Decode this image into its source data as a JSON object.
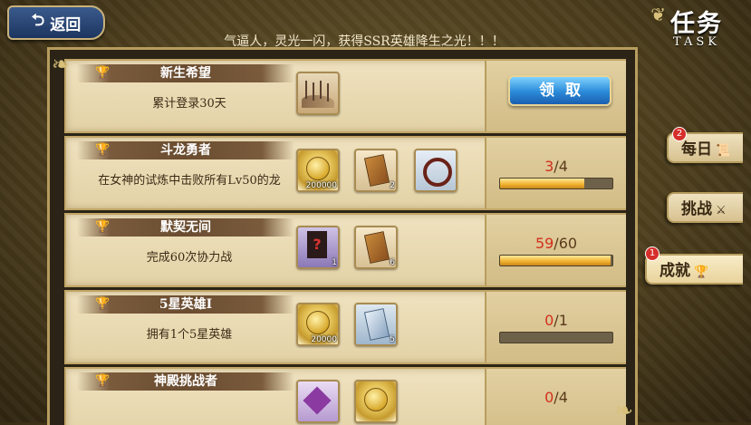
{
  "header": {
    "back_label": "返回",
    "title_cn": "任务",
    "title_en": "TASK",
    "marquee": "气逼人，灵光一闪，获得SSR英雄降生之光！！！"
  },
  "tabs": [
    {
      "label": "每日",
      "badge": "2",
      "active": false
    },
    {
      "label": "挑战",
      "badge": "",
      "active": false
    },
    {
      "label": "成就",
      "badge": "1",
      "active": true
    }
  ],
  "tasks": [
    {
      "name": "新生希望",
      "desc": "累计登录30天",
      "rewards": [
        {
          "kind": "landscape",
          "count": ""
        }
      ],
      "claim_label": "领取"
    },
    {
      "name": "斗龙勇者",
      "desc": "在女神的试炼中击败所有Lv50的龙",
      "rewards": [
        {
          "kind": "coin",
          "count": "200000"
        },
        {
          "kind": "card",
          "count": "2"
        },
        {
          "kind": "ring",
          "count": ""
        }
      ],
      "progress_current": "3",
      "progress_total": "/4",
      "progress_fraction": 0.75
    },
    {
      "name": "默契无间",
      "desc": "完成60次协力战",
      "rewards": [
        {
          "kind": "scroll",
          "count": "1"
        },
        {
          "kind": "card",
          "count": "6"
        }
      ],
      "progress_current": "59",
      "progress_total": "/60",
      "progress_fraction": 0.98
    },
    {
      "name": "5星英雄I",
      "desc": "拥有1个5星英雄",
      "rewards": [
        {
          "kind": "coin",
          "count": "20000"
        },
        {
          "kind": "blue-card",
          "count": "5"
        }
      ],
      "progress_current": "0",
      "progress_total": "/1",
      "progress_fraction": 0
    },
    {
      "name": "神殿挑战者",
      "desc": "",
      "rewards": [
        {
          "kind": "gem",
          "count": ""
        },
        {
          "kind": "coin",
          "count": ""
        }
      ],
      "progress_current": "0",
      "progress_total": "/4",
      "progress_fraction": 0
    }
  ]
}
